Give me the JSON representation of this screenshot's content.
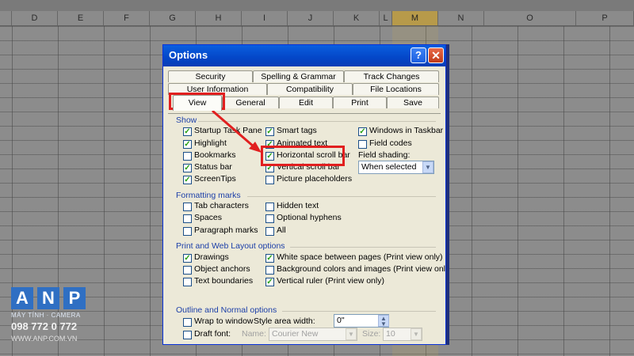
{
  "sheet": {
    "columns": [
      "D",
      "E",
      "F",
      "G",
      "H",
      "I",
      "J",
      "K",
      "L",
      "M",
      "N",
      "O",
      "P"
    ],
    "selected_column": "M"
  },
  "dialog": {
    "title": "Options",
    "help_glyph": "?",
    "close_glyph": "✕",
    "tabs_row1": [
      "Security",
      "Spelling & Grammar",
      "Track Changes"
    ],
    "tabs_row2": [
      "User Information",
      "Compatibility",
      "File Locations"
    ],
    "tabs_row3": [
      "View",
      "General",
      "Edit",
      "Print",
      "Save"
    ],
    "active_tab": "View",
    "show": {
      "heading": "Show",
      "col1": [
        {
          "label": "Startup Task Pane",
          "checked": true
        },
        {
          "label": "Highlight",
          "checked": true
        },
        {
          "label": "Bookmarks",
          "checked": false
        },
        {
          "label": "Status bar",
          "checked": true
        },
        {
          "label": "ScreenTips",
          "checked": true
        }
      ],
      "col2": [
        {
          "label": "Smart tags",
          "checked": true
        },
        {
          "label": "Animated text",
          "checked": true
        },
        {
          "label": "Horizontal scroll bar",
          "checked": true
        },
        {
          "label": "Vertical scroll bar",
          "checked": true
        },
        {
          "label": "Picture placeholders",
          "checked": false
        }
      ],
      "col3": [
        {
          "label": "Windows in Taskbar",
          "checked": true
        },
        {
          "label": "Field codes",
          "checked": false
        }
      ],
      "field_shading_label": "Field shading:",
      "field_shading_value": "When selected"
    },
    "formatting": {
      "heading": "Formatting marks",
      "col1": [
        {
          "label": "Tab characters",
          "checked": false
        },
        {
          "label": "Spaces",
          "checked": false
        },
        {
          "label": "Paragraph marks",
          "checked": false
        }
      ],
      "col2": [
        {
          "label": "Hidden text",
          "checked": false
        },
        {
          "label": "Optional hyphens",
          "checked": false
        },
        {
          "label": "All",
          "checked": false
        }
      ]
    },
    "print_web": {
      "heading": "Print and Web Layout options",
      "col1": [
        {
          "label": "Drawings",
          "checked": true
        },
        {
          "label": "Object anchors",
          "checked": false
        },
        {
          "label": "Text boundaries",
          "checked": false
        }
      ],
      "col2": [
        {
          "label": "White space between pages (Print view only)",
          "checked": true
        },
        {
          "label": "Background colors and images (Print view only)",
          "checked": false
        },
        {
          "label": "Vertical ruler (Print view only)",
          "checked": true
        }
      ]
    },
    "outline": {
      "heading": "Outline and Normal options",
      "wrap_label": "Wrap to window",
      "wrap_checked": false,
      "draft_label": "Draft font:",
      "draft_checked": false,
      "style_area_label": "Style area width:",
      "style_area_value": "0\"",
      "name_label": "Name:",
      "name_value": "Courier New",
      "size_label": "Size:",
      "size_value": "10"
    }
  },
  "watermark": {
    "letters": [
      "A",
      "N",
      "P"
    ],
    "line1": "MÁY TÍNH · CAMERA",
    "phone": "098 772 0 772",
    "url": "WWW.ANP.COM.VN"
  },
  "colors": {
    "highlight_red": "#e11f1f",
    "checkmark_green": "#25a010",
    "title_blue": "#0446c7"
  }
}
